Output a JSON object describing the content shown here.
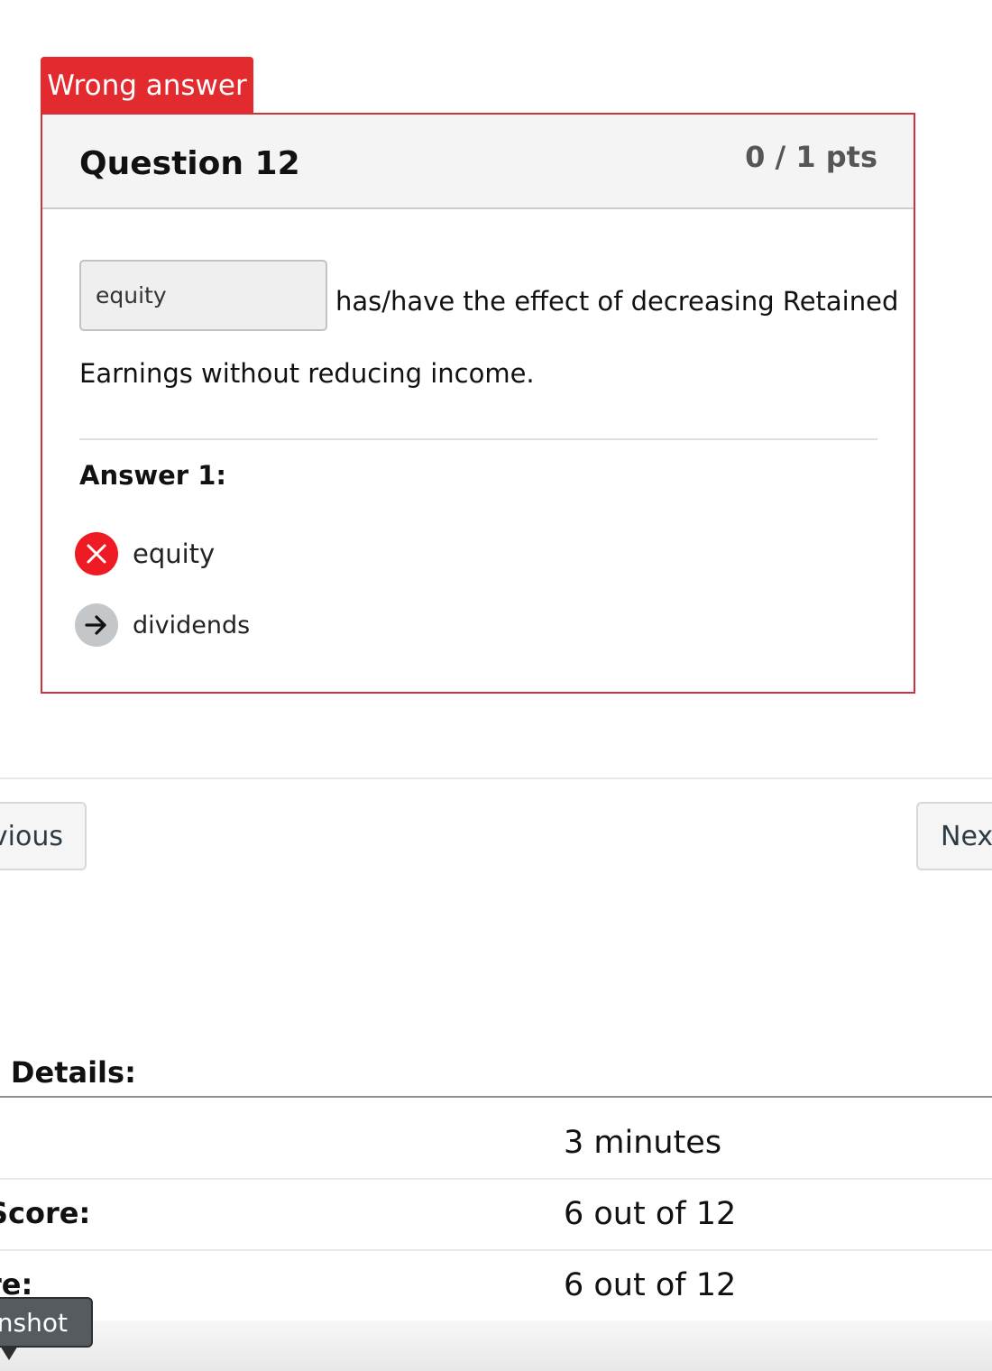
{
  "question": {
    "status_tab": "Wrong answer",
    "title": "Question 12",
    "points": "0 / 1 pts",
    "dropdown_value": "equity",
    "text_part1": "has/have the effect of decreasing Retained",
    "text_part2": "Earnings without reducing income.",
    "answer_label": "Answer 1:",
    "answers": [
      {
        "text": "equity",
        "status": "wrong",
        "icon": "x-mark-icon"
      },
      {
        "text": "dividends",
        "status": "correct",
        "icon": "right-arrow-icon"
      }
    ]
  },
  "navigation": {
    "previous_label": "vious",
    "next_label": "Next"
  },
  "details": {
    "title": "n Details:",
    "rows": [
      {
        "label": "",
        "value": "3 minutes"
      },
      {
        "label": "Score:",
        "value": "6 out of 12"
      },
      {
        "label": "re:",
        "value": "6 out of 12"
      }
    ]
  },
  "screenshot_tip": "nshot",
  "colors": {
    "wrong_red": "#e22a2f",
    "card_border": "#d0323b",
    "header_bg": "#f4f4f4"
  }
}
